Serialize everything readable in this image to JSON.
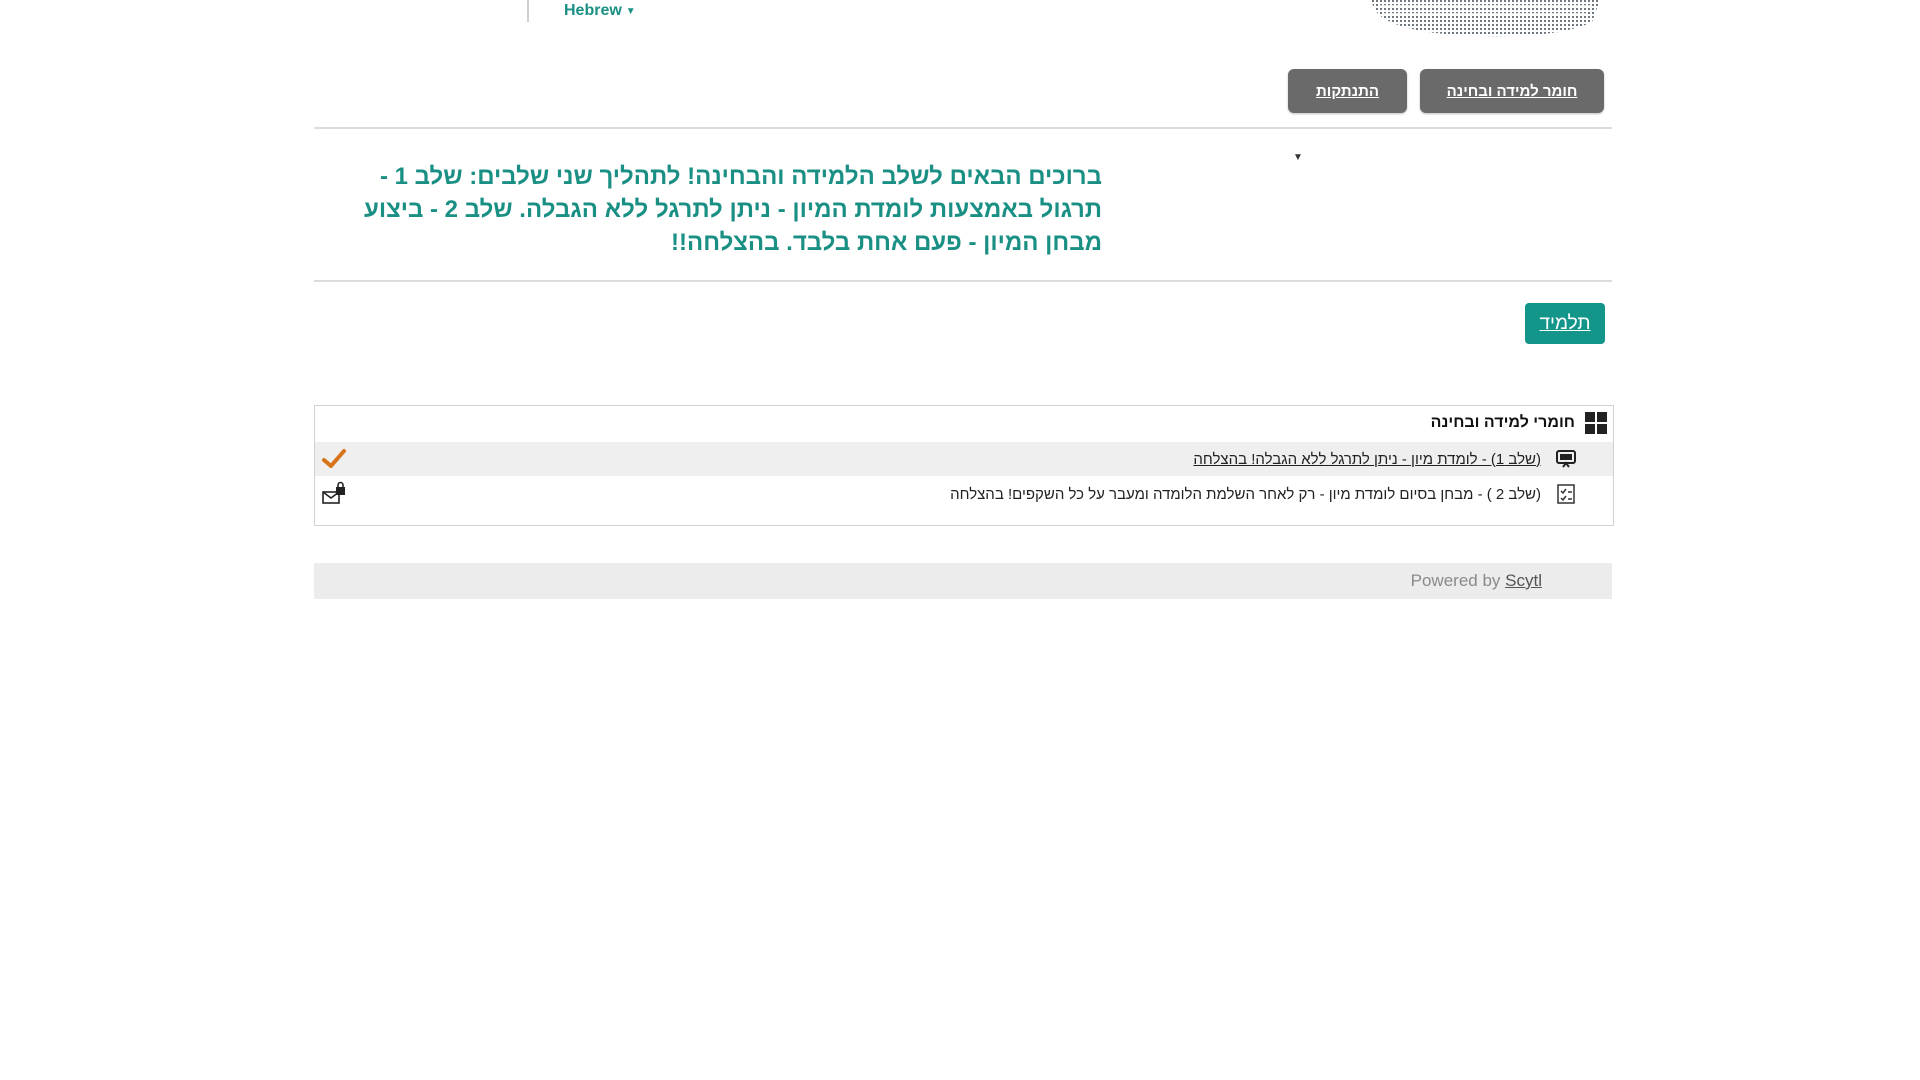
{
  "header": {
    "language": "Hebrew"
  },
  "nav": {
    "materials_label": "חומר למידה ובחינה",
    "logout_label": "התנתקות"
  },
  "welcome": {
    "text": "ברוכים הבאים לשלב הלמידה והבחינה! לתהליך שני שלבים: שלב 1 - תרגול באמצעות לומדת המיון - ניתן לתרגל ללא הגבלה. שלב 2 - ביצוע מבחן המיון - פעם אחת בלבד. בהצלחה!!"
  },
  "role": {
    "label": "תלמיד"
  },
  "panel": {
    "title": "חומרי למידה ובחינה",
    "items": [
      {
        "label": "(שלב 1) - לומדת מיון - ניתן לתרגל ללא הגבלה! בהצלחה",
        "icon": "presentation-icon",
        "status": "check-icon"
      },
      {
        "label": "(שלב 2 ) - מבחן בסיום לומדת מיון - רק לאחר השלמת הלומדה ומעבר על כל השקפים! בהצלחה",
        "icon": "exam-icon",
        "status": "locked-icon"
      }
    ]
  },
  "footer": {
    "powered_by": "Powered by",
    "brand": "Scytl"
  },
  "colors": {
    "accent": "#1a8f84",
    "button_dark": "#6a6a6a",
    "role_button": "#13958a",
    "check": "#d9731a"
  }
}
